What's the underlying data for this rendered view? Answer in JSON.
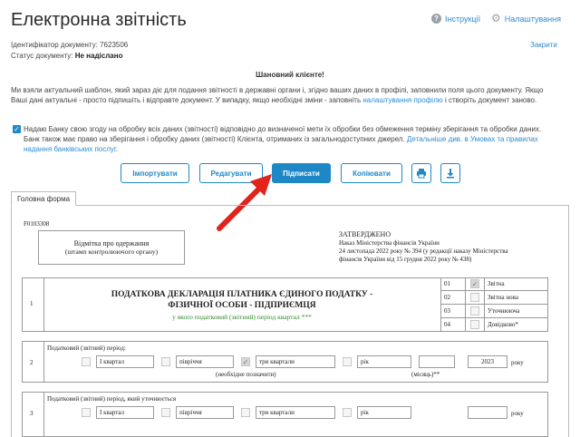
{
  "header": {
    "title": "Електронна звітність",
    "instructions": "Інструкції",
    "settings": "Налаштування"
  },
  "document": {
    "id_label": "Ідентифікатор документу:",
    "id_value": "7623506",
    "status_label": "Статус документу:",
    "status_value": "Не надіслано",
    "close": "Закрити"
  },
  "notice": {
    "greeting": "Шановний клієнте!",
    "text_1": "Ми взяли актуальний шаблон, який зараз діє для подання звітності в державні органи і, згідно ваших даних в профілі, заповнили поля цього документу. Якщо Ваші дані актуальні - просто підпишіть і відправте документ. У випадку, якщо необхідні зміни - заповніть ",
    "profile_link": "налаштування профілю",
    "text_2": " і створіть документ заново."
  },
  "consent": {
    "text": "Надаю Банку свою згоду на обробку всіх даних (звітності) відповідно до визначеної мети їх обробки без обмеження терміну зберігання та обробки даних. Банк також має право на зберігання і обробку даних (звітності) Клієнта, отриманих із загальнодоступних джерел. ",
    "link": "Детальніше див. в Умовах та правилах надання банківських послуг",
    "end": "."
  },
  "toolbar": {
    "import": "Імпортувати",
    "edit": "Редагувати",
    "sign": "Підписати",
    "copy": "Копіювати"
  },
  "tabs": {
    "main_form": "Головна форма"
  },
  "form": {
    "code": "F0103308",
    "stamp": "Відмітка про одержання",
    "stamp_sub": "(штамп контролюючого органу)",
    "approved": "ЗАТВЕРДЖЕНО",
    "approved_l1": "Наказ Міністерства фінансів України",
    "approved_l2": "24 листопада 2022 року № 394 (у редакції наказу Міністерства",
    "approved_l3": "фінансів України від 15 грудня 2022 року № 438)",
    "row1_num": "1",
    "decl_title_1": "ПОДАТКОВА ДЕКЛАРАЦІЯ ПЛАТНИКА ЄДИНОГО ПОДАТКУ -",
    "decl_title_2": "ФІЗИЧНОЇ ОСОБИ - ПІДПРИЄМЦЯ",
    "decl_sub": "у якого податковий (звітний) період квартал ***",
    "types": [
      {
        "code": "01",
        "label": "Звітна",
        "checked": true
      },
      {
        "code": "02",
        "label": "Звітна нова",
        "checked": false
      },
      {
        "code": "03",
        "label": "Уточнююча",
        "checked": false
      },
      {
        "code": "04",
        "label": "Довідково*",
        "checked": false
      }
    ],
    "row2_num": "2",
    "period_label": "Податковий (звітний) період:",
    "periods": [
      "І квартал",
      "півріччя",
      "три квартали",
      "рік"
    ],
    "period_checked": "три квартали",
    "year": "2023",
    "year_unit": "року",
    "note_mark": "(необхідне позначити)",
    "month_label": "(місяць)**",
    "row3_num": "3",
    "clarify_label": "Податковий (звітний) період, який уточнюється"
  }
}
